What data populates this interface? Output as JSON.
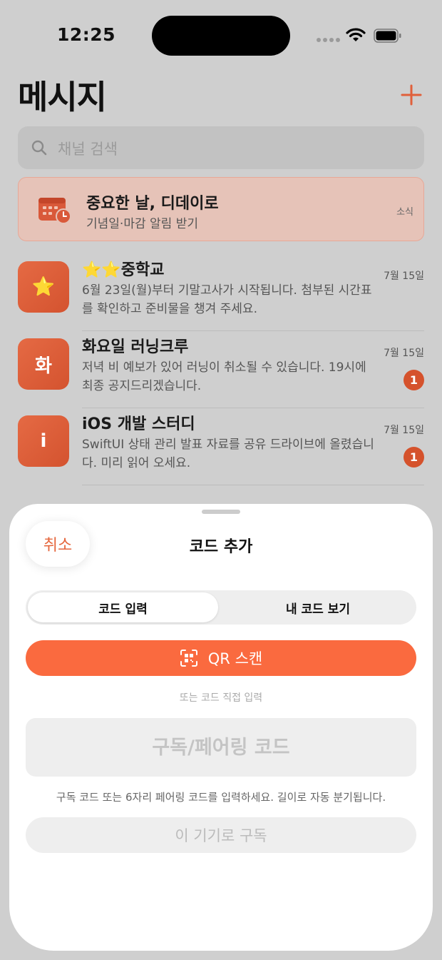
{
  "status_bar": {
    "time": "12:25"
  },
  "header": {
    "title": "메시지"
  },
  "search": {
    "placeholder": "채널 검색"
  },
  "promo": {
    "title": "중요한 날, 디데이로",
    "subtitle": "기념일·마감 알림 받기",
    "tag": "소식"
  },
  "channels": [
    {
      "avatar": "⭐",
      "name": "⭐⭐중학교",
      "preview": "6월 23일(월)부터 기말고사가 시작됩니다. 첨부된 시간표를 확인하고 준비물을 챙겨 주세요.",
      "date": "7월 15일",
      "badge": ""
    },
    {
      "avatar": "화",
      "name": "화요일 러닝크루",
      "preview": "저녁 비 예보가 있어 러닝이 취소될 수 있습니다. 19시에 최종 공지드리겠습니다.",
      "date": "7월 15일",
      "badge": "1"
    },
    {
      "avatar": "i",
      "name": "iOS 개발 스터디",
      "preview": "SwiftUI 상태 관리 발표 자료를 공유 드라이브에 올렸습니다. 미리 읽어 오세요.",
      "date": "7월 15일",
      "badge": "1"
    }
  ],
  "sheet": {
    "cancel_label": "취소",
    "title": "코드 추가",
    "tabs": [
      {
        "label": "코드 입력",
        "selected": true
      },
      {
        "label": "내 코드 보기",
        "selected": false
      }
    ],
    "qr_button_label": "QR 스캔",
    "or_text": "또는 코드 직접 입력",
    "code_input": {
      "value": "",
      "placeholder": "구독/페어링 코드"
    },
    "hint": "구독 코드 또는 6자리 페어링 코드를 입력하세요. 길이로 자동 분기됩니다.",
    "subscribe_label": "이 기기로 구독"
  },
  "colors": {
    "accent": "#fa6a3f",
    "badge": "#d5522c",
    "avatar": "#e0603b"
  }
}
